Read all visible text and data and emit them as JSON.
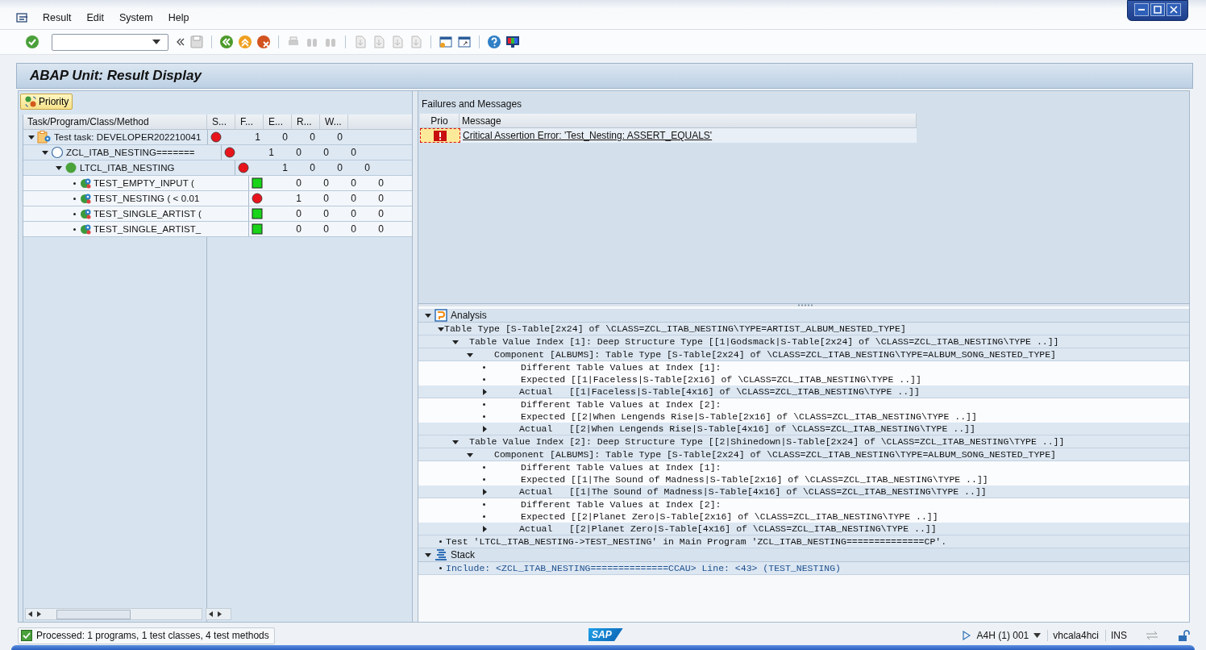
{
  "menu": [
    "Result",
    "Edit",
    "System",
    "Help"
  ],
  "title": "ABAP Unit: Result Display",
  "priority_button": "Priority",
  "tree": {
    "columns": [
      "Task/Program/Class/Method",
      "S...",
      "F...",
      "E...",
      "R...",
      "W..."
    ],
    "rows": [
      {
        "name": "Test task: DEVELOPER202210041",
        "kind": "task",
        "expanded": true,
        "failed": true,
        "values": [
          "1",
          "0",
          "0",
          "0"
        ],
        "children": [
          {
            "name": "ZCL_ITAB_NESTING=======",
            "kind": "program",
            "expanded": true,
            "failed": true,
            "values": [
              "1",
              "0",
              "0",
              "0"
            ],
            "children": [
              {
                "name": "LTCL_ITAB_NESTING",
                "kind": "class",
                "expanded": true,
                "failed": true,
                "values": [
                  "1",
                  "0",
                  "0",
                  "0"
                ],
                "children": [
                  {
                    "name": "TEST_EMPTY_INPUT (",
                    "kind": "method",
                    "failed": false,
                    "values": [
                      "0",
                      "0",
                      "0",
                      "0"
                    ]
                  },
                  {
                    "name": "TEST_NESTING ( < 0.01",
                    "kind": "method",
                    "failed": true,
                    "values": [
                      "1",
                      "0",
                      "0",
                      "0"
                    ]
                  },
                  {
                    "name": "TEST_SINGLE_ARTIST (",
                    "kind": "method",
                    "failed": false,
                    "values": [
                      "0",
                      "0",
                      "0",
                      "0"
                    ]
                  },
                  {
                    "name": "TEST_SINGLE_ARTIST_",
                    "kind": "method",
                    "failed": false,
                    "values": [
                      "0",
                      "0",
                      "0",
                      "0"
                    ]
                  }
                ]
              }
            ]
          }
        ]
      }
    ]
  },
  "messages": {
    "title": "Failures and Messages",
    "columns": [
      "Prio",
      "Message"
    ],
    "rows": [
      {
        "kind": "critical",
        "message": "Critical Assertion Error: 'Test_Nesting: ASSERT_EQUALS'",
        "selected": true
      }
    ]
  },
  "analysis": [
    {
      "title": "Analysis",
      "kind": "analysis",
      "expanded": true,
      "children": [
        {
          "text": "Table Type [S-Table[2x24] of \\CLASS=ZCL_ITAB_NESTING\\TYPE=ARTIST_ALBUM_NESTED_TYPE]",
          "kind": "node",
          "expanded": true,
          "children": [
            {
              "text": "Table Value Index [1]: Deep Structure Type [[1|Godsmack|S-Table[2x24] of \\CLASS=ZCL_ITAB_NESTING\\TYPE ..]]",
              "kind": "node",
              "expanded": true,
              "children": [
                {
                  "text": "Component [ALBUMS]: Table Type [S-Table[2x24] of \\CLASS=ZCL_ITAB_NESTING\\TYPE=ALBUM_SONG_NESTED_TYPE]",
                  "kind": "node",
                  "expanded": true,
                  "children": [
                    {
                      "text": "Different Table Values at Index [1]:",
                      "kind": "leaf"
                    },
                    {
                      "text": "Expected [[1|Faceless|S-Table[2x16] of \\CLASS=ZCL_ITAB_NESTING\\TYPE ..]]",
                      "kind": "leaf"
                    },
                    {
                      "text": "Actual   [[1|Faceless|S-Table[4x16] of \\CLASS=ZCL_ITAB_NESTING\\TYPE ..]]",
                      "kind": "node",
                      "expanded": false
                    },
                    {
                      "text": "Different Table Values at Index [2]:",
                      "kind": "leaf"
                    },
                    {
                      "text": "Expected [[2|When Lengends Rise|S-Table[2x16] of \\CLASS=ZCL_ITAB_NESTING\\TYPE ..]]",
                      "kind": "leaf"
                    },
                    {
                      "text": "Actual   [[2|When Lengends Rise|S-Table[4x16] of \\CLASS=ZCL_ITAB_NESTING\\TYPE ..]]",
                      "kind": "node",
                      "expanded": false
                    }
                  ]
                }
              ]
            },
            {
              "text": "Table Value Index [2]: Deep Structure Type [[2|Shinedown|S-Table[2x24] of \\CLASS=ZCL_ITAB_NESTING\\TYPE ..]]",
              "kind": "node",
              "expanded": true,
              "children": [
                {
                  "text": "Component [ALBUMS]: Table Type [S-Table[2x24] of \\CLASS=ZCL_ITAB_NESTING\\TYPE=ALBUM_SONG_NESTED_TYPE]",
                  "kind": "node",
                  "expanded": true,
                  "children": [
                    {
                      "text": "Different Table Values at Index [1]:",
                      "kind": "leaf"
                    },
                    {
                      "text": "Expected [[1|The Sound of Madness|S-Table[2x16] of \\CLASS=ZCL_ITAB_NESTING\\TYPE ..]]",
                      "kind": "leaf"
                    },
                    {
                      "text": "Actual   [[1|The Sound of Madness|S-Table[4x16] of \\CLASS=ZCL_ITAB_NESTING\\TYPE ..]]",
                      "kind": "node",
                      "expanded": false
                    },
                    {
                      "text": "Different Table Values at Index [2]:",
                      "kind": "leaf"
                    },
                    {
                      "text": "Expected [[2|Planet Zero|S-Table[2x16] of \\CLASS=ZCL_ITAB_NESTING\\TYPE ..]]",
                      "kind": "leaf"
                    },
                    {
                      "text": "Actual   [[2|Planet Zero|S-Table[4x16] of \\CLASS=ZCL_ITAB_NESTING\\TYPE ..]]",
                      "kind": "node",
                      "expanded": false
                    }
                  ]
                }
              ]
            }
          ]
        },
        {
          "text": "Test 'LTCL_ITAB_NESTING->TEST_NESTING' in Main Program 'ZCL_ITAB_NESTING==============CP'.",
          "kind": "leaf"
        }
      ]
    },
    {
      "title": "Stack",
      "kind": "stack",
      "expanded": true,
      "children": [
        {
          "text": "Include: <ZCL_ITAB_NESTING==============CCAU> Line: <43> (TEST_NESTING)",
          "kind": "leaf"
        }
      ]
    }
  ],
  "status_bar": {
    "kind": "success",
    "message": "Processed: 1 programs, 1 test classes, 4 test methods",
    "logo": "SAP",
    "system": "A4H (1) 001",
    "server": "vhcala4hci",
    "mode": "INS"
  }
}
